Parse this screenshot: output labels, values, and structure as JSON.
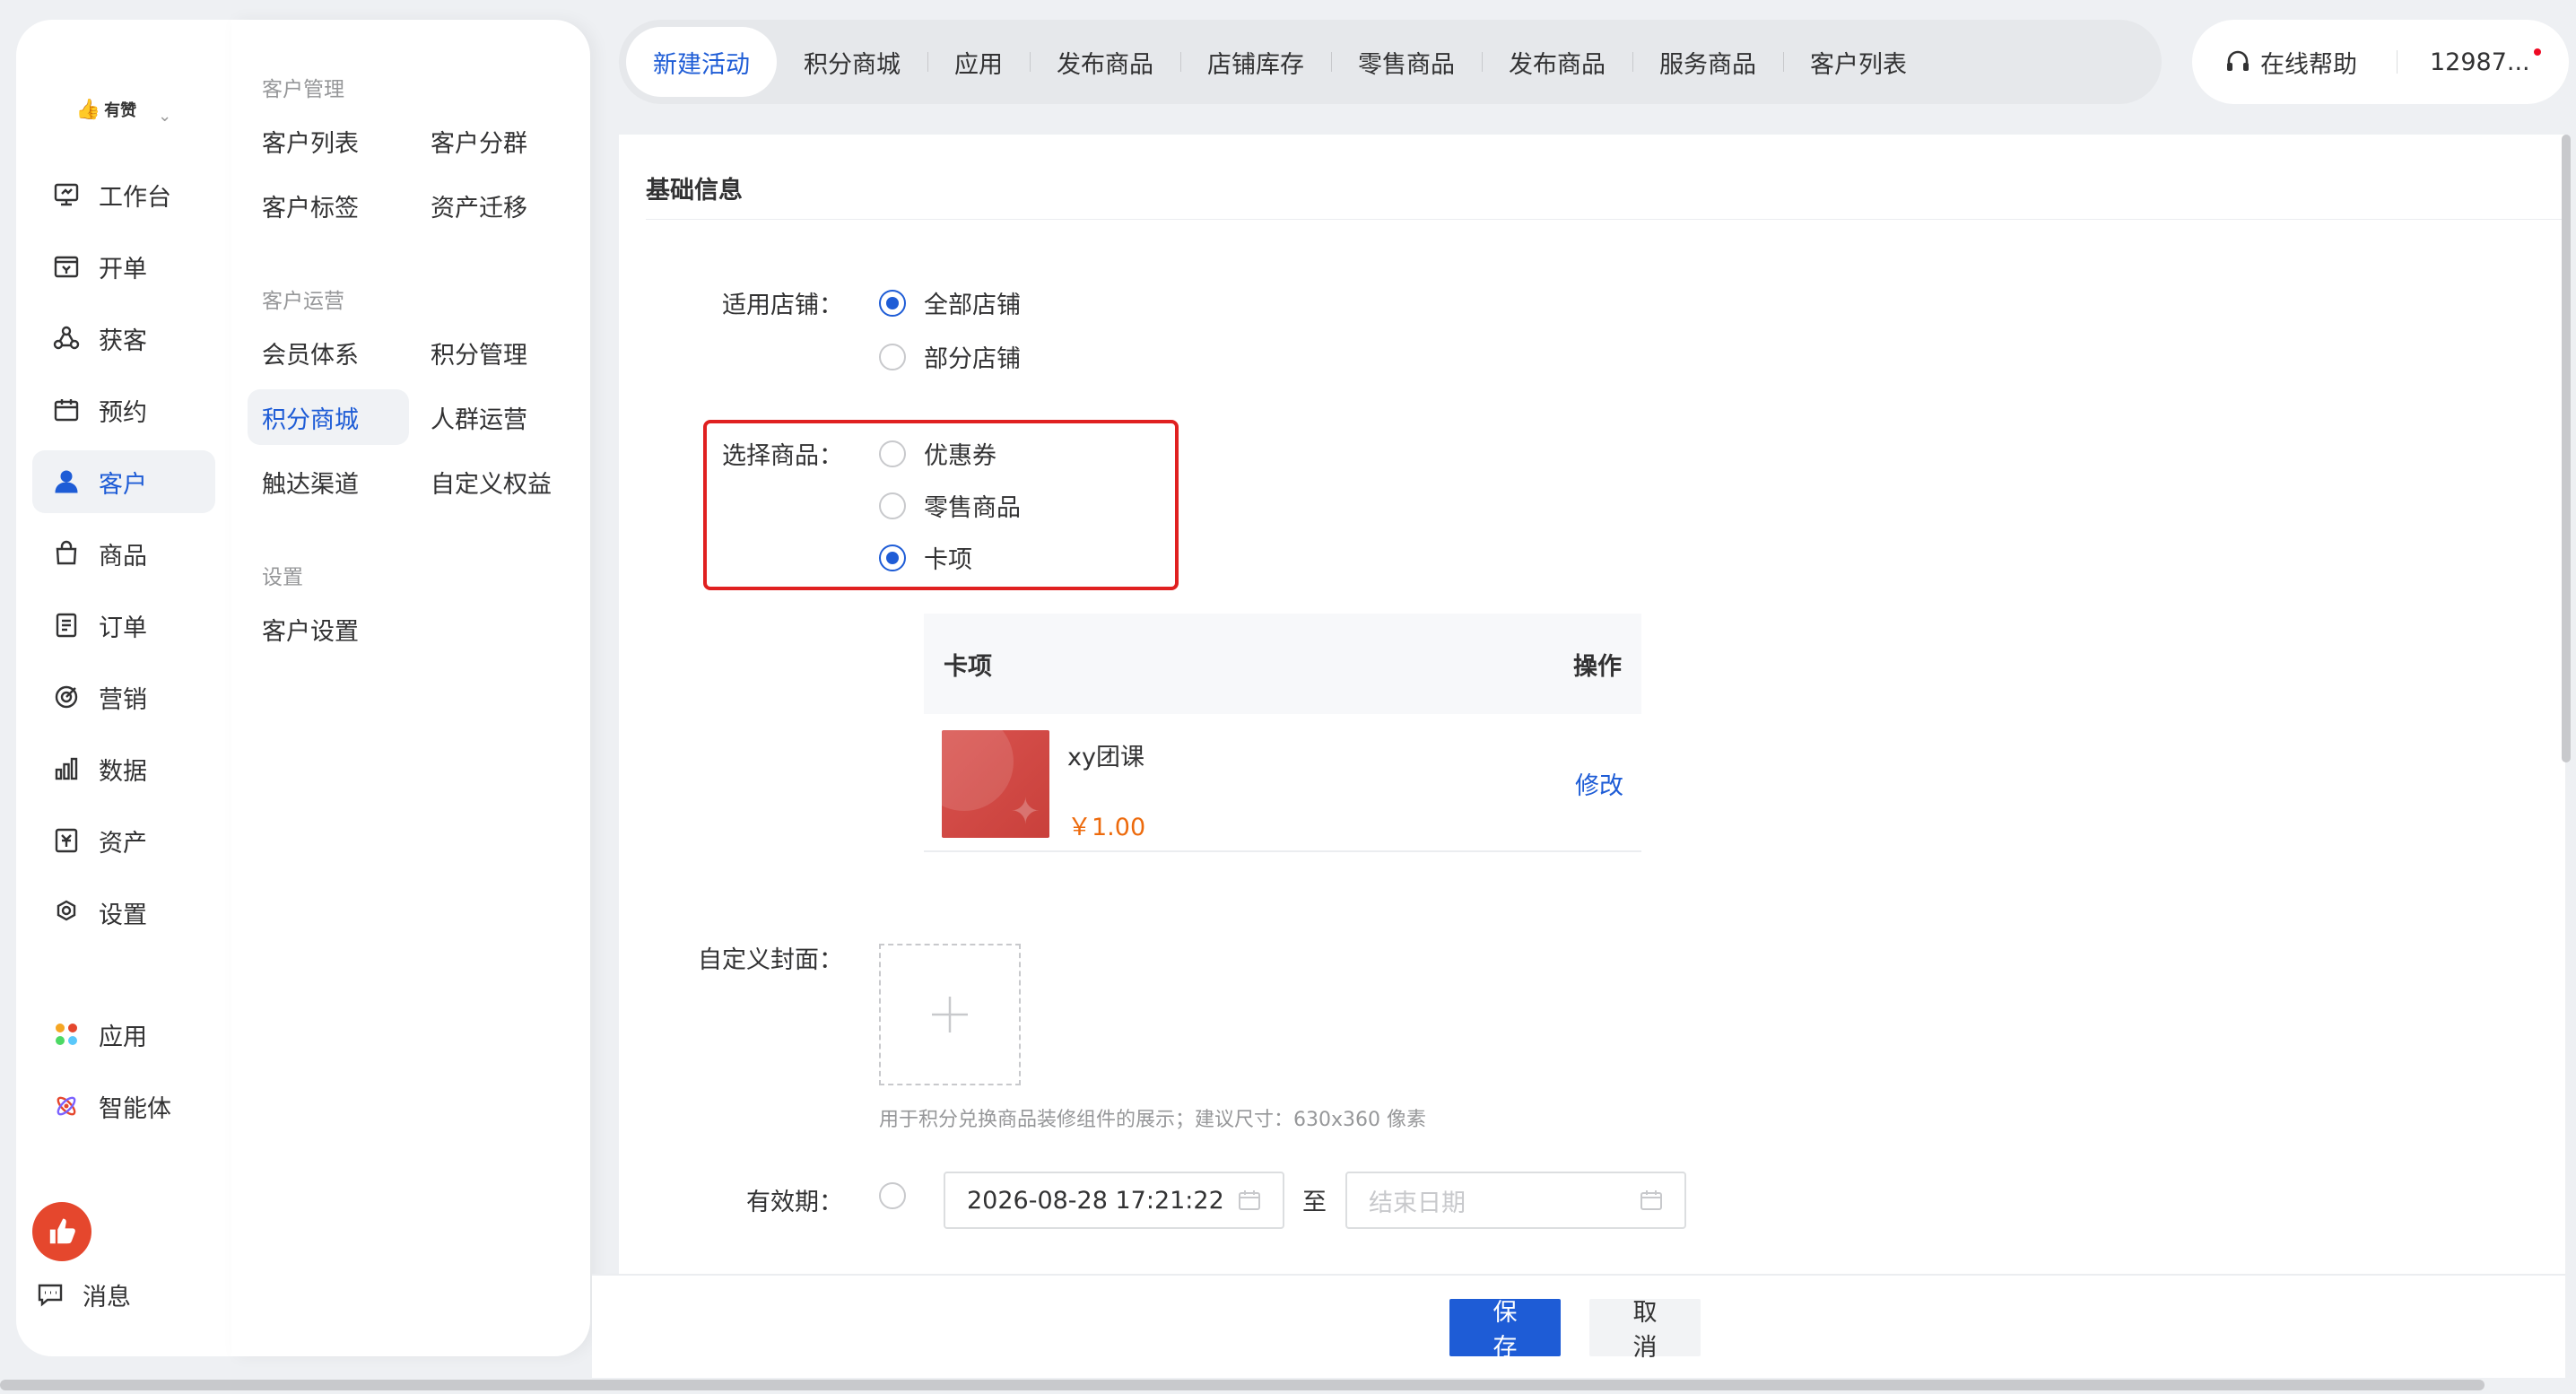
{
  "brand": {
    "name": "有赞"
  },
  "nav": {
    "items": [
      {
        "label": "工作台",
        "icon": "workbench-icon"
      },
      {
        "label": "开单",
        "icon": "order-create-icon"
      },
      {
        "label": "获客",
        "icon": "acquire-icon"
      },
      {
        "label": "预约",
        "icon": "calendar-icon"
      },
      {
        "label": "客户",
        "icon": "user-icon",
        "active": true
      },
      {
        "label": "商品",
        "icon": "bag-icon"
      },
      {
        "label": "订单",
        "icon": "document-icon"
      },
      {
        "label": "营销",
        "icon": "target-icon"
      },
      {
        "label": "数据",
        "icon": "bar-chart-icon"
      },
      {
        "label": "资产",
        "icon": "asset-icon"
      },
      {
        "label": "设置",
        "icon": "gear-icon"
      }
    ],
    "apps_label": "应用",
    "agent_label": "智能体",
    "message_label": "消息"
  },
  "subnav": {
    "group1": "客户管理",
    "group2": "客户运营",
    "group3": "设置",
    "customer_list": "客户列表",
    "customer_group": "客户分群",
    "customer_tag": "客户标签",
    "asset_migrate": "资产迁移",
    "member_system": "会员体系",
    "points_manage": "积分管理",
    "points_mall": "积分商城",
    "crowd_ops": "人群运营",
    "reach_channel": "触达渠道",
    "custom_rights": "自定义权益",
    "customer_settings": "客户设置"
  },
  "tabs": [
    {
      "label": "新建活动",
      "active": true
    },
    {
      "label": "积分商城"
    },
    {
      "label": "应用"
    },
    {
      "label": "发布商品"
    },
    {
      "label": "店铺库存"
    },
    {
      "label": "零售商品"
    },
    {
      "label": "发布商品"
    },
    {
      "label": "服务商品"
    },
    {
      "label": "客户列表"
    }
  ],
  "topright": {
    "help": "在线帮助",
    "user": "12987..."
  },
  "form": {
    "section_title": "基础信息",
    "store_label": "适用店铺：",
    "store_all": "全部店铺",
    "store_part": "部分店铺",
    "goods_label": "选择商品：",
    "goods_coupon": "优惠券",
    "goods_retail": "零售商品",
    "goods_card": "卡项",
    "table_col_card": "卡项",
    "table_col_action": "操作",
    "item_name": "xy团课",
    "item_price": "￥1.00",
    "item_edit": "修改",
    "cover_label": "自定义封面：",
    "cover_hint": "用于积分兑换商品装修组件的展示；建议尺寸：630x360 像素",
    "validity_label": "有效期：",
    "start_date": "2026-08-28 17:21:22",
    "to": "至",
    "end_placeholder": "结束日期"
  },
  "footer": {
    "save": "保存",
    "cancel": "取消"
  },
  "colors": {
    "accent": "#1e5cd6",
    "highlight": "#e02020",
    "price": "#ed6a0c"
  }
}
